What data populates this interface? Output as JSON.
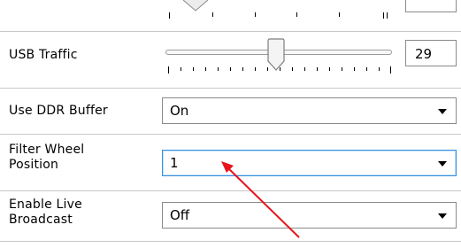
{
  "rows": {
    "usb_traffic": {
      "label": "USB Traffic",
      "value": "29"
    },
    "use_ddr_buffer": {
      "label": "Use DDR Buffer",
      "value": "On"
    },
    "filter_wheel_position": {
      "label_line1": "Filter Wheel",
      "label_line2": "Position",
      "value": "1"
    },
    "enable_live_broadcast": {
      "label_line1": "Enable Live",
      "label_line2": "Broadcast",
      "value": "Off"
    }
  },
  "annotation_color": "#e8141c"
}
